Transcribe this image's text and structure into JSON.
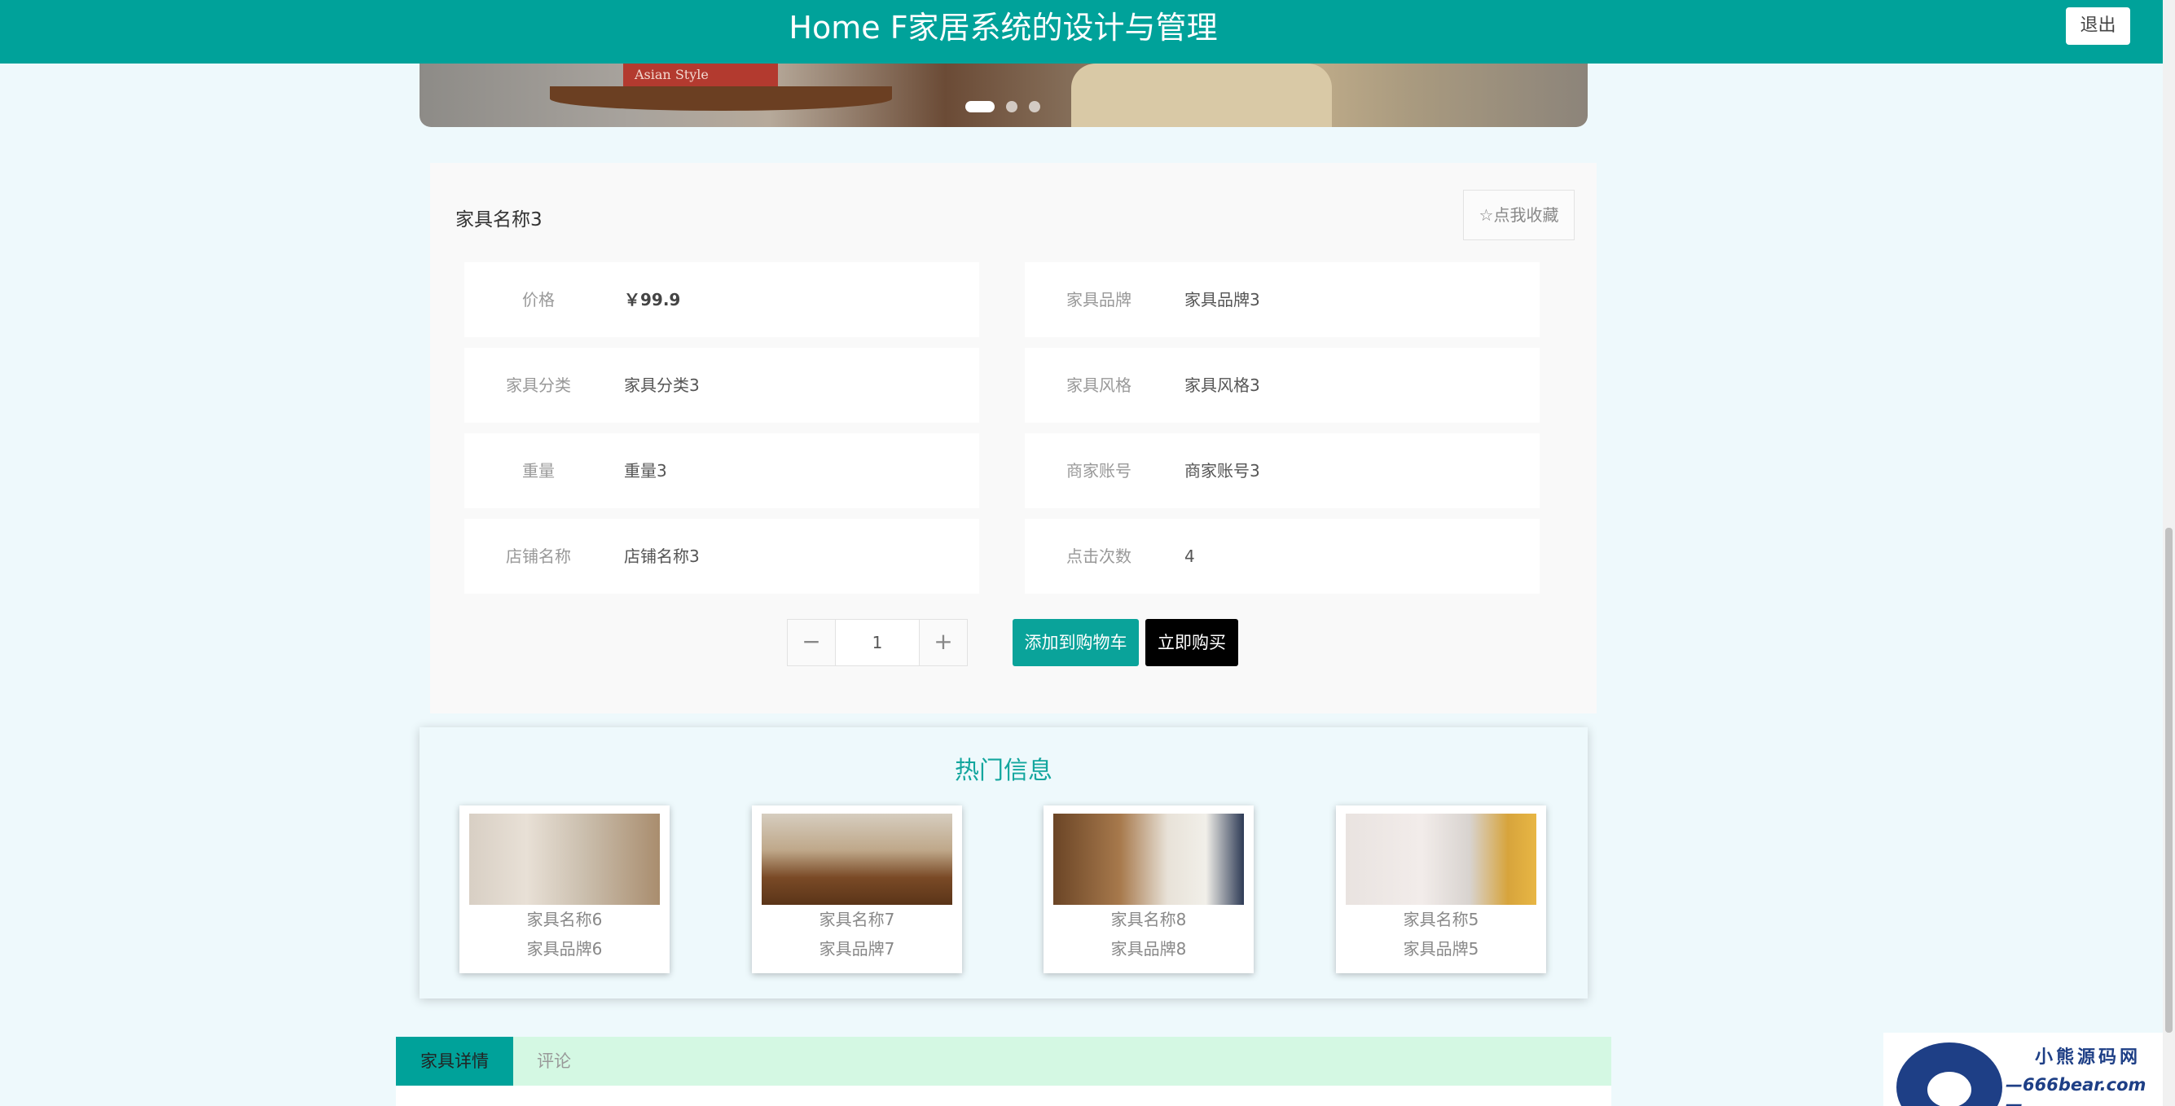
{
  "header": {
    "title": "Home F家居系统的设计与管理",
    "logout_label": "退出"
  },
  "banner": {
    "book_text": "Asian Style"
  },
  "product": {
    "name": "家具名称3",
    "favorite_label": "☆点我收藏",
    "fields": [
      {
        "label": "价格",
        "value": "￥99.9"
      },
      {
        "label": "家具品牌",
        "value": "家具品牌3"
      },
      {
        "label": "家具分类",
        "value": "家具分类3"
      },
      {
        "label": "家具风格",
        "value": "家具风格3"
      },
      {
        "label": "重量",
        "value": "重量3"
      },
      {
        "label": "商家账号",
        "value": "商家账号3"
      },
      {
        "label": "店铺名称",
        "value": "店铺名称3"
      },
      {
        "label": "点击次数",
        "value": "4"
      }
    ],
    "quantity": "1",
    "minus": "−",
    "plus": "+",
    "add_to_cart": "添加到购物车",
    "buy_now": "立即购买"
  },
  "hot": {
    "title": "热门信息",
    "items": [
      {
        "name": "家具名称6",
        "brand": "家具品牌6"
      },
      {
        "name": "家具名称7",
        "brand": "家具品牌7"
      },
      {
        "name": "家具名称8",
        "brand": "家具品牌8"
      },
      {
        "name": "家具名称5",
        "brand": "家具品牌5"
      }
    ]
  },
  "tabs": [
    {
      "label": "家具详情"
    },
    {
      "label": "评论"
    }
  ],
  "watermark": {
    "line1": "小熊源码网",
    "line2": "—666bear.com—"
  },
  "colors": {
    "accent": "#00a29a",
    "tab_bg": "#d4f8e3",
    "page_bg": "#eef9fc"
  }
}
